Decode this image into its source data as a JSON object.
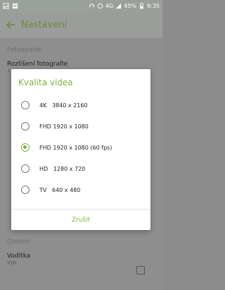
{
  "status": {
    "network": "4G",
    "battery": "45%",
    "time": "9:35"
  },
  "appbar": {
    "title": "Nastavení"
  },
  "settings": {
    "section_photo": "Fotoaparát",
    "item_resolution_name": "Rozlišení fotografie",
    "item_resolution_sub": "1",
    "section_other": "Ostatní",
    "item_guide_name": "Vodítka",
    "item_guide_sub": "Vyp"
  },
  "dialog": {
    "title": "Kvalita videa",
    "options": [
      {
        "label": "4K   3840 x 2160",
        "checked": false
      },
      {
        "label": "FHD 1920 x 1080",
        "checked": false
      },
      {
        "label": "FHD 1920 x 1080 (60 fps)",
        "checked": true
      },
      {
        "label": "HD   1280 x 720",
        "checked": false
      },
      {
        "label": "TV   640 x 480",
        "checked": false
      }
    ],
    "cancel": "Zrušit"
  }
}
